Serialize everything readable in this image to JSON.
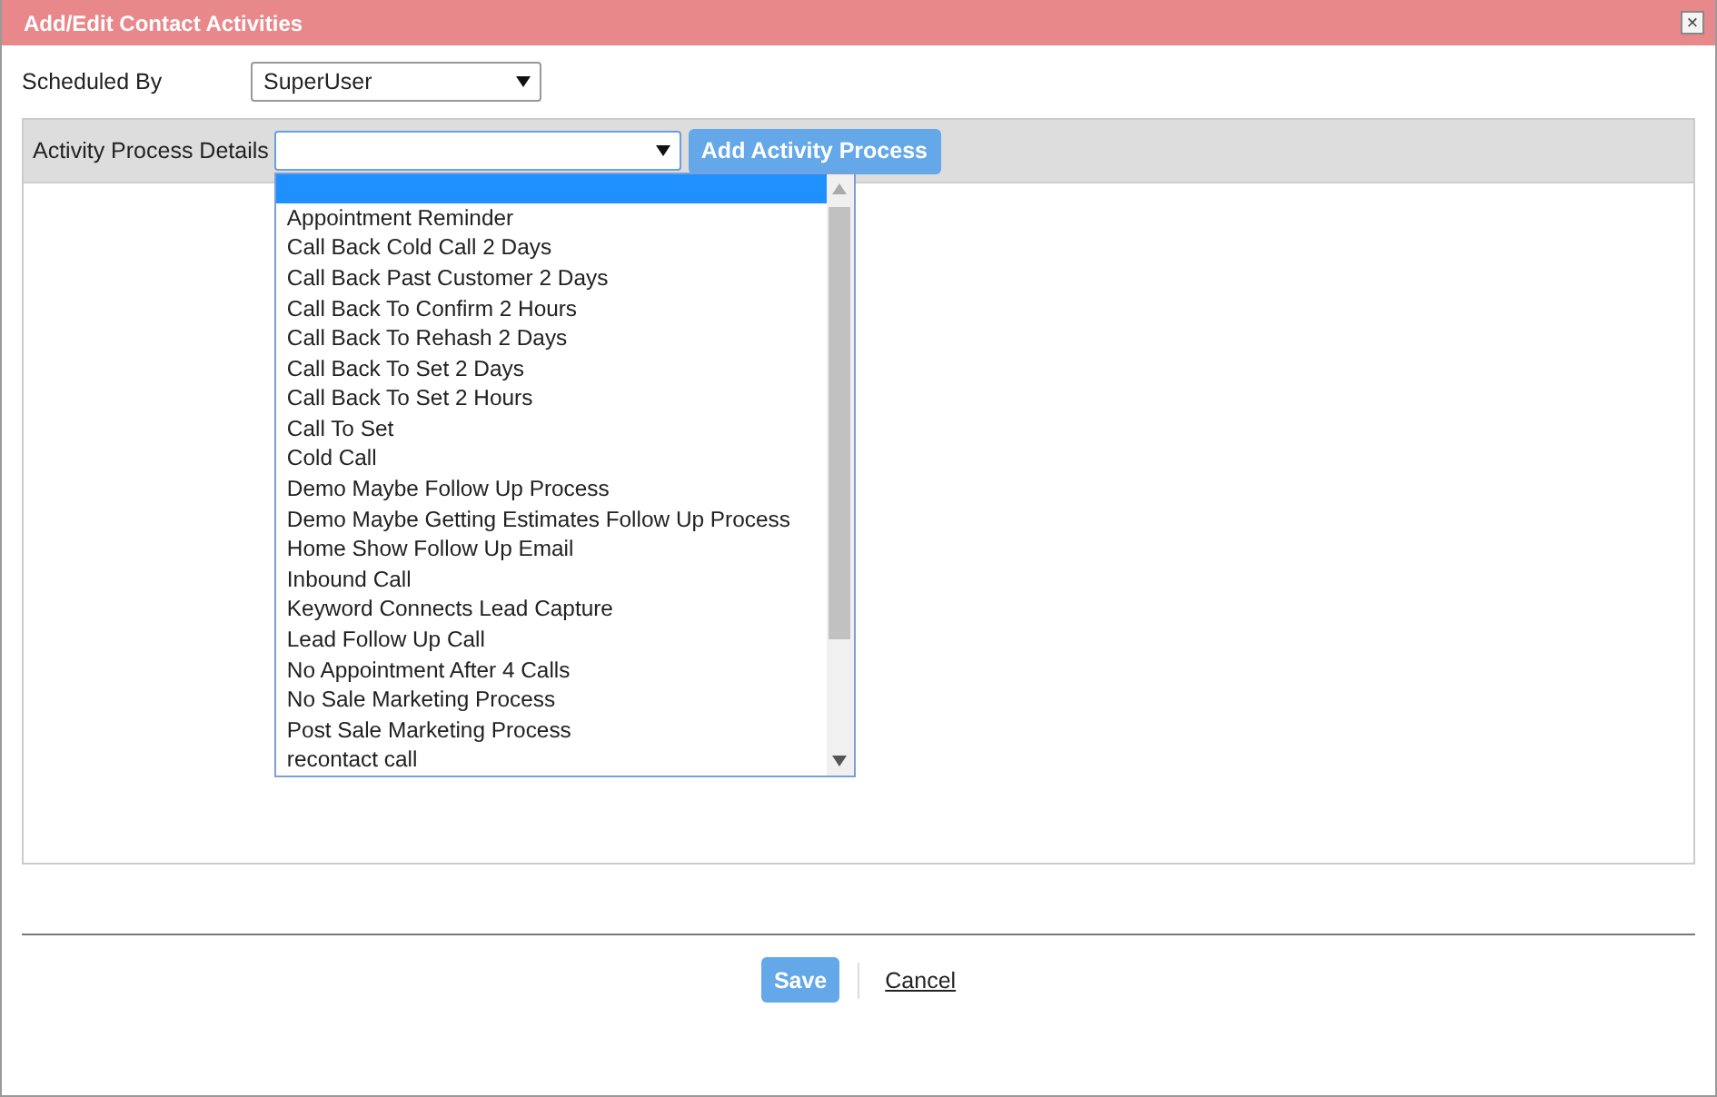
{
  "window": {
    "title": "Add/Edit Contact Activities",
    "close": "×"
  },
  "scheduled_by": {
    "label": "Scheduled By",
    "value": "SuperUser"
  },
  "activity_process": {
    "label": "Activity Process Details",
    "button": "Add Activity Process",
    "dropdown": {
      "open": true,
      "blank_selected": true,
      "options": [
        {
          "label": "Appointment Reminder",
          "selected": false
        },
        {
          "label": "Call Back Cold Call 2 Days",
          "selected": false
        },
        {
          "label": "Call Back Past Customer 2 Days",
          "selected": false
        },
        {
          "label": "Call Back To Confirm 2 Hours",
          "selected": false
        },
        {
          "label": "Call Back To Rehash 2 Days",
          "selected": false
        },
        {
          "label": "Call Back To Set 2 Days",
          "selected": false
        },
        {
          "label": "Call Back To Set 2 Hours",
          "selected": false
        },
        {
          "label": "Call To Set",
          "selected": false
        },
        {
          "label": "Cold Call",
          "selected": false
        },
        {
          "label": "Demo Maybe Follow Up Process",
          "selected": false
        },
        {
          "label": "Demo Maybe Getting Estimates Follow Up Process",
          "selected": false
        },
        {
          "label": "Home Show Follow Up Email",
          "selected": false
        },
        {
          "label": "Inbound Call",
          "selected": false
        },
        {
          "label": "Keyword Connects Lead Capture",
          "selected": false
        },
        {
          "label": "Lead Follow Up Call",
          "selected": false
        },
        {
          "label": "No Appointment After 4 Calls",
          "selected": false
        },
        {
          "label": "No Sale Marketing Process",
          "selected": false
        },
        {
          "label": "Post Sale Marketing Process",
          "selected": false
        },
        {
          "label": "recontact call",
          "selected": false
        }
      ]
    }
  },
  "footer": {
    "save": "Save",
    "cancel": "Cancel"
  }
}
